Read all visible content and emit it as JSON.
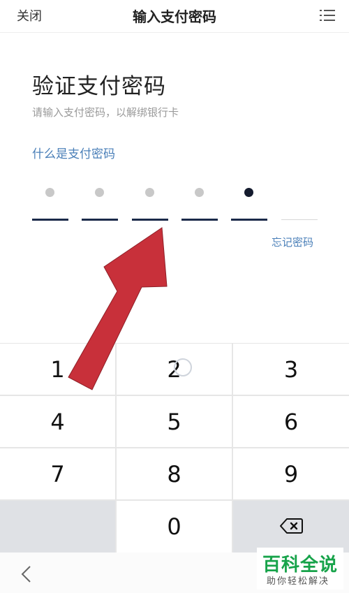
{
  "header": {
    "close_label": "关闭",
    "title": "输入支付密码"
  },
  "main": {
    "heading": "验证支付密码",
    "subtitle": "请输入支付密码，以解绑银行卡",
    "help_link": "什么是支付密码",
    "forgot_link": "忘记密码"
  },
  "pin": {
    "length": 6,
    "entered": 5,
    "colors": {
      "filled_dot": "#c8c8c8",
      "current_dot": "#141b2e",
      "active_line": "#1b2a4a",
      "inactive_line": "#d7d7d7"
    }
  },
  "keypad": {
    "keys": [
      "1",
      "2",
      "3",
      "4",
      "5",
      "6",
      "7",
      "8",
      "9",
      "",
      "0",
      ""
    ],
    "delete_icon": "backspace-icon"
  },
  "overlay": {
    "annotation": "arrow-pointer",
    "color": "#c8303a"
  },
  "watermark": {
    "main": "百科全说",
    "sub": "助你轻松解决"
  },
  "icons": {
    "menu": "menu-icon",
    "back": "back-arrow-icon"
  }
}
